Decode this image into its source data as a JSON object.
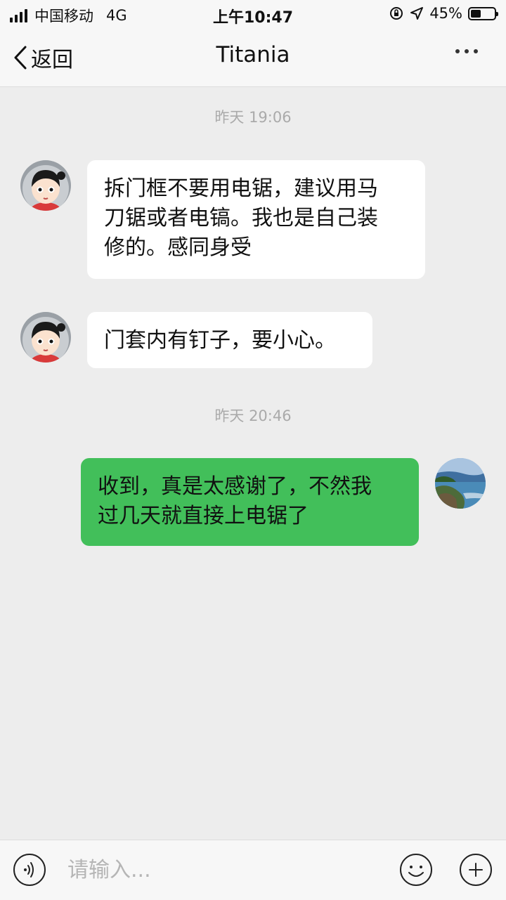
{
  "status_bar": {
    "carrier": "中国移动",
    "network": "4G",
    "time": "上午10:47",
    "battery_text": "45%",
    "battery_level": 0.45
  },
  "nav": {
    "back_label": "返回",
    "title": "Titania",
    "more_icon": "more-dots-icon"
  },
  "messages": [
    {
      "type": "timestamp",
      "text": "昨天 19:06"
    },
    {
      "type": "incoming",
      "lines": [
        "拆门框不要用电锯，建议用马",
        "刀锯或者电镐。我也是自己装",
        "修的。感同身受"
      ]
    },
    {
      "type": "incoming",
      "lines": [
        "门套内有钉子，要小心。"
      ]
    },
    {
      "type": "timestamp",
      "text": "昨天 20:46"
    },
    {
      "type": "outgoing",
      "lines": [
        "收到，真是太感谢了，不然我",
        "过几天就直接上电锯了"
      ]
    }
  ],
  "input_bar": {
    "placeholder": "请输入...",
    "voice_icon": "voice-icon",
    "emoji_icon": "emoji-icon",
    "plus_icon": "plus-icon"
  },
  "colors": {
    "background": "#ededed",
    "outgoing_bubble": "#42bf5a",
    "incoming_bubble": "#ffffff",
    "timestamp": "#aaaaaa"
  }
}
